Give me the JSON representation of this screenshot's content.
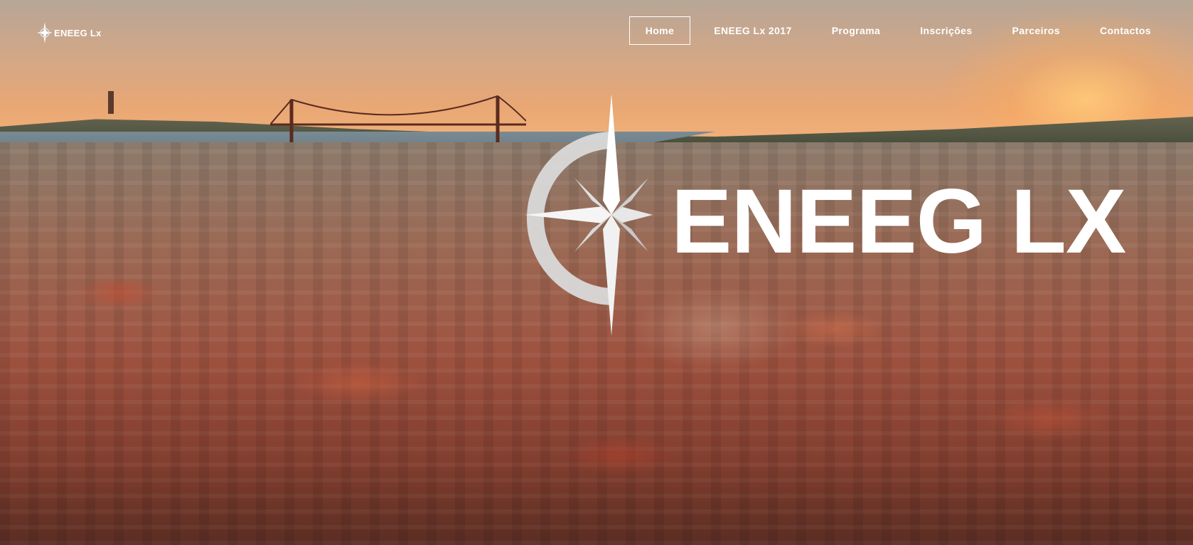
{
  "brand": {
    "logo_text": "ENEEG Lx",
    "hero_text": "ENEEG LX"
  },
  "nav": {
    "items": [
      {
        "label": "Home",
        "active": true
      },
      {
        "label": "ENEEG Lx 2017",
        "active": false
      },
      {
        "label": "Programa",
        "active": false
      },
      {
        "label": "Inscrições",
        "active": false
      },
      {
        "label": "Parceiros",
        "active": false
      },
      {
        "label": "Contactos",
        "active": false
      }
    ]
  },
  "hero": {
    "background_image": "Lisbon cityscape at sunset",
    "compass_icon": "compass-rose-icon"
  },
  "colors": {
    "nav_text": "#ffffff",
    "active_border": "#ffffff",
    "sky": "#e9a774",
    "roofs": "#a0523f"
  }
}
